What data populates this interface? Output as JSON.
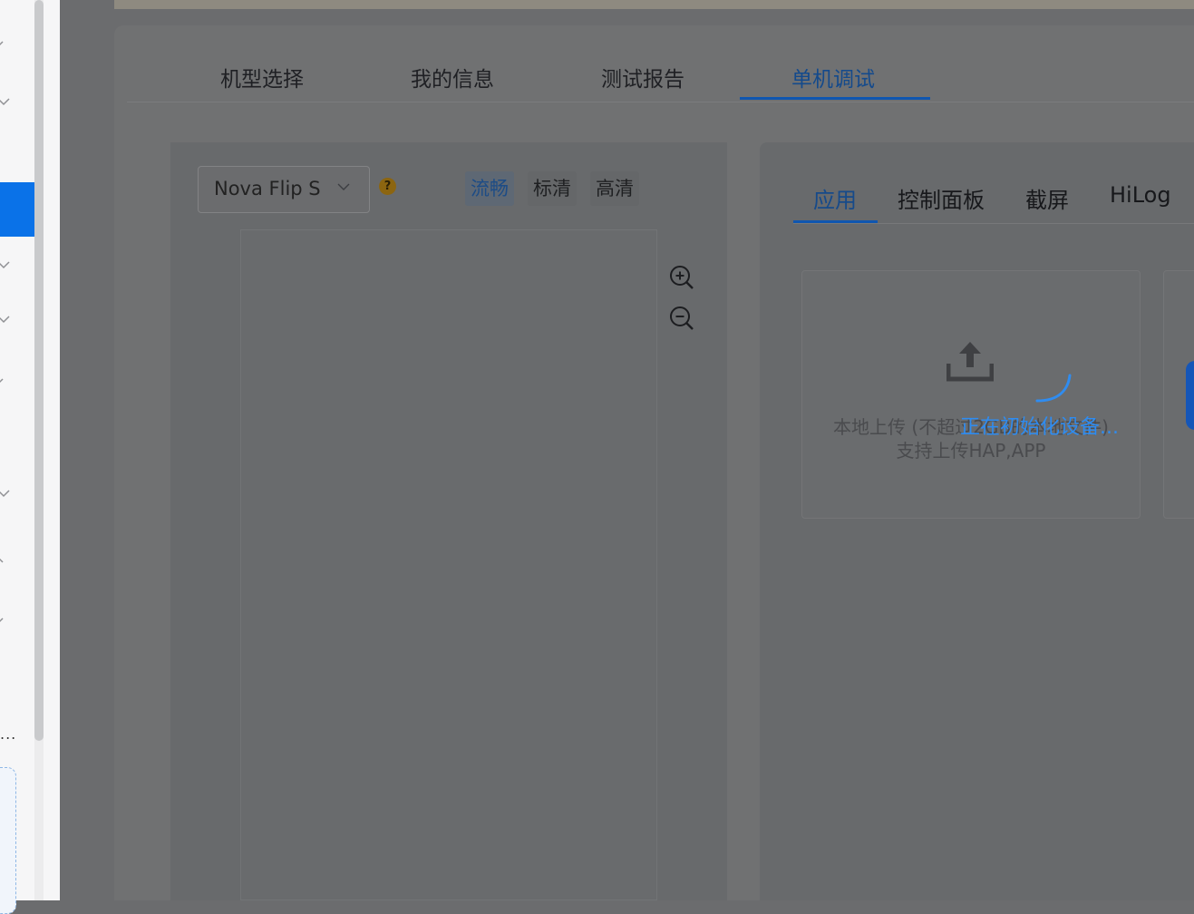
{
  "main_tabs": [
    {
      "label": "机型选择"
    },
    {
      "label": "我的信息"
    },
    {
      "label": "测试报告"
    },
    {
      "label": "单机调试",
      "active": true
    }
  ],
  "device": {
    "model": "Nova Flip S",
    "help_icon": "?",
    "quality": [
      {
        "label": "流畅",
        "active": true
      },
      {
        "label": "标清"
      },
      {
        "label": "高清"
      }
    ]
  },
  "right_tabs": [
    {
      "label": "应用",
      "active": true
    },
    {
      "label": "控制面板"
    },
    {
      "label": "截屏"
    },
    {
      "label": "HiLog"
    }
  ],
  "upload": {
    "line1": "本地上传 (不超过2GB的本地文件)",
    "line2": "支持上传HAP,APP"
  },
  "loading": {
    "text": "正在初始化设备..."
  },
  "sidebar": {
    "more": "..."
  },
  "colors": {
    "accent": "#0a72e8",
    "loading": "#2f8cf0"
  }
}
